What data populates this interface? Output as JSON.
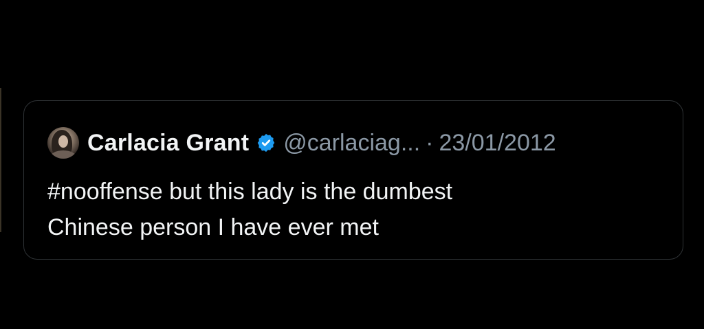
{
  "tweet": {
    "display_name": "Carlacia Grant",
    "handle": "@carlaciag...",
    "separator": "·",
    "date": "23/01/2012",
    "text": "#nooffense but this lady is the dumbest\nChinese person I have ever met",
    "verified_icon": "verified-badge-icon",
    "avatar_icon": "user-avatar"
  },
  "colors": {
    "background": "#000000",
    "card_border": "#2f3336",
    "primary_text": "#f2f4f5",
    "secondary_text": "#8b98a5",
    "verified": "#1d9bf0"
  }
}
